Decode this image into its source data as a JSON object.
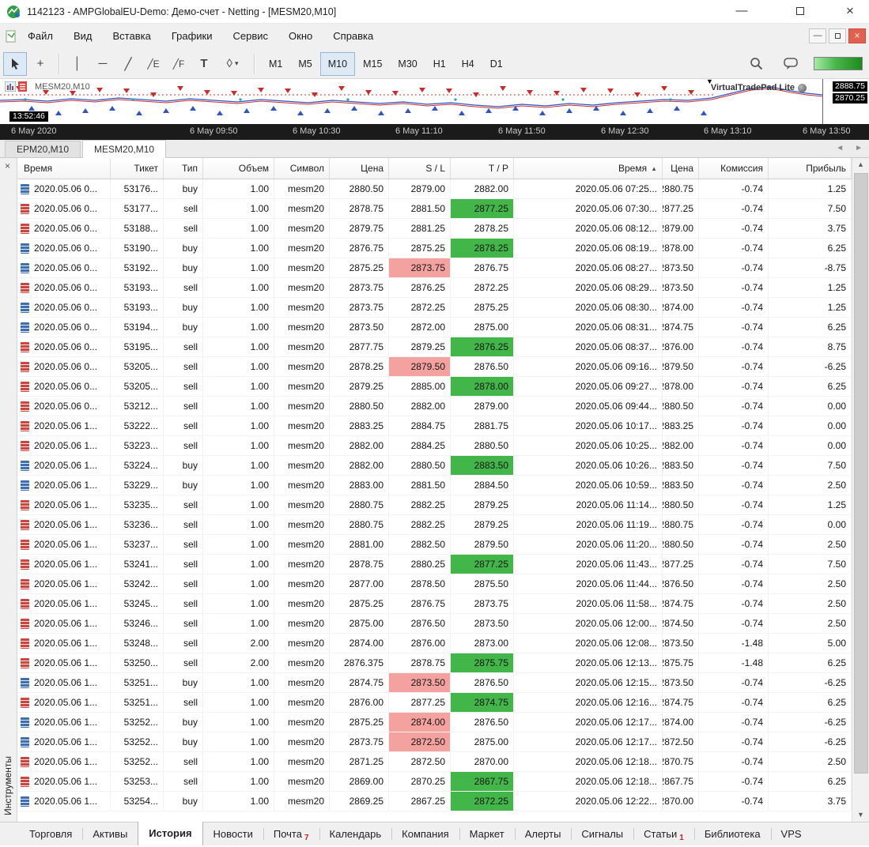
{
  "window": {
    "title": "1142123 - AMPGlobalEU-Demo: Демо-счет - Netting - [MESM20,M10]"
  },
  "menu": {
    "items": [
      "Файл",
      "Вид",
      "Вставка",
      "Графики",
      "Сервис",
      "Окно",
      "Справка"
    ]
  },
  "toolbar": {
    "timeframes": [
      "M1",
      "M5",
      "M10",
      "M15",
      "M30",
      "H1",
      "H4",
      "D1"
    ],
    "active_timeframe": "M10"
  },
  "chart": {
    "symbol_label": "MESM20,M10",
    "vtp_label": "VirtualTradePad Lite",
    "price_high": "2888.75",
    "price_current": "2870.25",
    "clock": "13:52:46",
    "time_axis": [
      "6 May 2020",
      "6 May 09:50",
      "6 May 10:30",
      "6 May 11:10",
      "6 May 11:50",
      "6 May 12:30",
      "6 May 13:10",
      "6 May 13:50"
    ]
  },
  "chart_tabs": {
    "tabs": [
      "EPM20,M10",
      "MESM20,M10"
    ],
    "active_index": 1
  },
  "toolbox": {
    "vertical_tab": "Инструменты",
    "columns": [
      "Время",
      "Тикет",
      "Тип",
      "Объем",
      "Символ",
      "Цена",
      "S / L",
      "T / P",
      "Время",
      "Цена",
      "Комиссия",
      "Прибыль"
    ],
    "sorted_column_index": 8,
    "rows": [
      [
        "2020.05.06 0...",
        "53176...",
        "buy",
        "1.00",
        "mesm20",
        "2880.50",
        "2879.00",
        "2882.00",
        "2020.05.06 07:25...",
        "2880.75",
        "-0.74",
        "1.25",
        ""
      ],
      [
        "2020.05.06 0...",
        "53177...",
        "sell",
        "1.00",
        "mesm20",
        "2878.75",
        "2881.50",
        "2877.25",
        "2020.05.06 07:30...",
        "2877.25",
        "-0.74",
        "7.50",
        "tp"
      ],
      [
        "2020.05.06 0...",
        "53188...",
        "sell",
        "1.00",
        "mesm20",
        "2879.75",
        "2881.25",
        "2878.25",
        "2020.05.06 08:12...",
        "2879.00",
        "-0.74",
        "3.75",
        ""
      ],
      [
        "2020.05.06 0...",
        "53190...",
        "buy",
        "1.00",
        "mesm20",
        "2876.75",
        "2875.25",
        "2878.25",
        "2020.05.06 08:19...",
        "2878.00",
        "-0.74",
        "6.25",
        "tp"
      ],
      [
        "2020.05.06 0...",
        "53192...",
        "buy",
        "1.00",
        "mesm20",
        "2875.25",
        "2873.75",
        "2876.75",
        "2020.05.06 08:27...",
        "2873.50",
        "-0.74",
        "-8.75",
        "sl"
      ],
      [
        "2020.05.06 0...",
        "53193...",
        "sell",
        "1.00",
        "mesm20",
        "2873.75",
        "2876.25",
        "2872.25",
        "2020.05.06 08:29...",
        "2873.50",
        "-0.74",
        "1.25",
        ""
      ],
      [
        "2020.05.06 0...",
        "53193...",
        "buy",
        "1.00",
        "mesm20",
        "2873.75",
        "2872.25",
        "2875.25",
        "2020.05.06 08:30...",
        "2874.00",
        "-0.74",
        "1.25",
        ""
      ],
      [
        "2020.05.06 0...",
        "53194...",
        "buy",
        "1.00",
        "mesm20",
        "2873.50",
        "2872.00",
        "2875.00",
        "2020.05.06 08:31...",
        "2874.75",
        "-0.74",
        "6.25",
        ""
      ],
      [
        "2020.05.06 0...",
        "53195...",
        "sell",
        "1.00",
        "mesm20",
        "2877.75",
        "2879.25",
        "2876.25",
        "2020.05.06 08:37...",
        "2876.00",
        "-0.74",
        "8.75",
        "tp"
      ],
      [
        "2020.05.06 0...",
        "53205...",
        "sell",
        "1.00",
        "mesm20",
        "2878.25",
        "2879.50",
        "2876.50",
        "2020.05.06 09:16...",
        "2879.50",
        "-0.74",
        "-6.25",
        "sl"
      ],
      [
        "2020.05.06 0...",
        "53205...",
        "sell",
        "1.00",
        "mesm20",
        "2879.25",
        "2885.00",
        "2878.00",
        "2020.05.06 09:27...",
        "2878.00",
        "-0.74",
        "6.25",
        "tp"
      ],
      [
        "2020.05.06 0...",
        "53212...",
        "sell",
        "1.00",
        "mesm20",
        "2880.50",
        "2882.00",
        "2879.00",
        "2020.05.06 09:44...",
        "2880.50",
        "-0.74",
        "0.00",
        ""
      ],
      [
        "2020.05.06 1...",
        "53222...",
        "sell",
        "1.00",
        "mesm20",
        "2883.25",
        "2884.75",
        "2881.75",
        "2020.05.06 10:17...",
        "2883.25",
        "-0.74",
        "0.00",
        ""
      ],
      [
        "2020.05.06 1...",
        "53223...",
        "sell",
        "1.00",
        "mesm20",
        "2882.00",
        "2884.25",
        "2880.50",
        "2020.05.06 10:25...",
        "2882.00",
        "-0.74",
        "0.00",
        ""
      ],
      [
        "2020.05.06 1...",
        "53224...",
        "buy",
        "1.00",
        "mesm20",
        "2882.00",
        "2880.50",
        "2883.50",
        "2020.05.06 10:26...",
        "2883.50",
        "-0.74",
        "7.50",
        "tp"
      ],
      [
        "2020.05.06 1...",
        "53229...",
        "buy",
        "1.00",
        "mesm20",
        "2883.00",
        "2881.50",
        "2884.50",
        "2020.05.06 10:59...",
        "2883.50",
        "-0.74",
        "2.50",
        ""
      ],
      [
        "2020.05.06 1...",
        "53235...",
        "sell",
        "1.00",
        "mesm20",
        "2880.75",
        "2882.25",
        "2879.25",
        "2020.05.06 11:14...",
        "2880.50",
        "-0.74",
        "1.25",
        ""
      ],
      [
        "2020.05.06 1...",
        "53236...",
        "sell",
        "1.00",
        "mesm20",
        "2880.75",
        "2882.25",
        "2879.25",
        "2020.05.06 11:19...",
        "2880.75",
        "-0.74",
        "0.00",
        ""
      ],
      [
        "2020.05.06 1...",
        "53237...",
        "sell",
        "1.00",
        "mesm20",
        "2881.00",
        "2882.50",
        "2879.50",
        "2020.05.06 11:20...",
        "2880.50",
        "-0.74",
        "2.50",
        ""
      ],
      [
        "2020.05.06 1...",
        "53241...",
        "sell",
        "1.00",
        "mesm20",
        "2878.75",
        "2880.25",
        "2877.25",
        "2020.05.06 11:43...",
        "2877.25",
        "-0.74",
        "7.50",
        "tp"
      ],
      [
        "2020.05.06 1...",
        "53242...",
        "sell",
        "1.00",
        "mesm20",
        "2877.00",
        "2878.50",
        "2875.50",
        "2020.05.06 11:44...",
        "2876.50",
        "-0.74",
        "2.50",
        ""
      ],
      [
        "2020.05.06 1...",
        "53245...",
        "sell",
        "1.00",
        "mesm20",
        "2875.25",
        "2876.75",
        "2873.75",
        "2020.05.06 11:58...",
        "2874.75",
        "-0.74",
        "2.50",
        ""
      ],
      [
        "2020.05.06 1...",
        "53246...",
        "sell",
        "1.00",
        "mesm20",
        "2875.00",
        "2876.50",
        "2873.50",
        "2020.05.06 12:00...",
        "2874.50",
        "-0.74",
        "2.50",
        ""
      ],
      [
        "2020.05.06 1...",
        "53248...",
        "sell",
        "2.00",
        "mesm20",
        "2874.00",
        "2876.00",
        "2873.00",
        "2020.05.06 12:08...",
        "2873.50",
        "-1.48",
        "5.00",
        ""
      ],
      [
        "2020.05.06 1...",
        "53250...",
        "sell",
        "2.00",
        "mesm20",
        "2876.375",
        "2878.75",
        "2875.75",
        "2020.05.06 12:13...",
        "2875.75",
        "-1.48",
        "6.25",
        "tp"
      ],
      [
        "2020.05.06 1...",
        "53251...",
        "buy",
        "1.00",
        "mesm20",
        "2874.75",
        "2873.50",
        "2876.50",
        "2020.05.06 12:15...",
        "2873.50",
        "-0.74",
        "-6.25",
        "sl"
      ],
      [
        "2020.05.06 1...",
        "53251...",
        "sell",
        "1.00",
        "mesm20",
        "2876.00",
        "2877.25",
        "2874.75",
        "2020.05.06 12:16...",
        "2874.75",
        "-0.74",
        "6.25",
        "tp"
      ],
      [
        "2020.05.06 1...",
        "53252...",
        "buy",
        "1.00",
        "mesm20",
        "2875.25",
        "2874.00",
        "2876.50",
        "2020.05.06 12:17...",
        "2874.00",
        "-0.74",
        "-6.25",
        "sl"
      ],
      [
        "2020.05.06 1...",
        "53252...",
        "buy",
        "1.00",
        "mesm20",
        "2873.75",
        "2872.50",
        "2875.00",
        "2020.05.06 12:17...",
        "2872.50",
        "-0.74",
        "-6.25",
        "sl"
      ],
      [
        "2020.05.06 1...",
        "53252...",
        "sell",
        "1.00",
        "mesm20",
        "2871.25",
        "2872.50",
        "2870.00",
        "2020.05.06 12:18...",
        "2870.75",
        "-0.74",
        "2.50",
        ""
      ],
      [
        "2020.05.06 1...",
        "53253...",
        "sell",
        "1.00",
        "mesm20",
        "2869.00",
        "2870.25",
        "2867.75",
        "2020.05.06 12:18...",
        "2867.75",
        "-0.74",
        "6.25",
        "tp"
      ],
      [
        "2020.05.06 1...",
        "53254...",
        "buy",
        "1.00",
        "mesm20",
        "2869.25",
        "2867.25",
        "2872.25",
        "2020.05.06 12:22...",
        "2870.00",
        "-0.74",
        "3.75",
        "tp"
      ]
    ]
  },
  "bottom_tabs": [
    {
      "label": "Торговля"
    },
    {
      "label": "Активы"
    },
    {
      "label": "История",
      "active": true
    },
    {
      "label": "Новости"
    },
    {
      "label": "Почта",
      "badge": "7"
    },
    {
      "label": "Календарь"
    },
    {
      "label": "Компания"
    },
    {
      "label": "Маркет"
    },
    {
      "label": "Алерты"
    },
    {
      "label": "Сигналы"
    },
    {
      "label": "Статьи",
      "badge": "1"
    },
    {
      "label": "Библиотека"
    },
    {
      "label": "VPS"
    }
  ],
  "icons": {
    "minimize": "—",
    "close": "×",
    "crosshair": "+",
    "vline": "│",
    "hline": "─",
    "trendline": "╱",
    "channel": "╱E",
    "fibonacci": "╱F",
    "text_tool": "T",
    "shapes": "◊",
    "dropdown": "▾",
    "scroll_up": "▲",
    "scroll_down": "▼",
    "tab_prev": "◄",
    "tab_next": "►",
    "sort_asc": "▲",
    "marker": "▼",
    "panel_close": "×"
  },
  "colors": {
    "tp_hit": "#43b649",
    "sl_hit": "#f4a2a0",
    "buy": "#3f6fae",
    "sell": "#c9473f",
    "progress": "#49b649"
  }
}
